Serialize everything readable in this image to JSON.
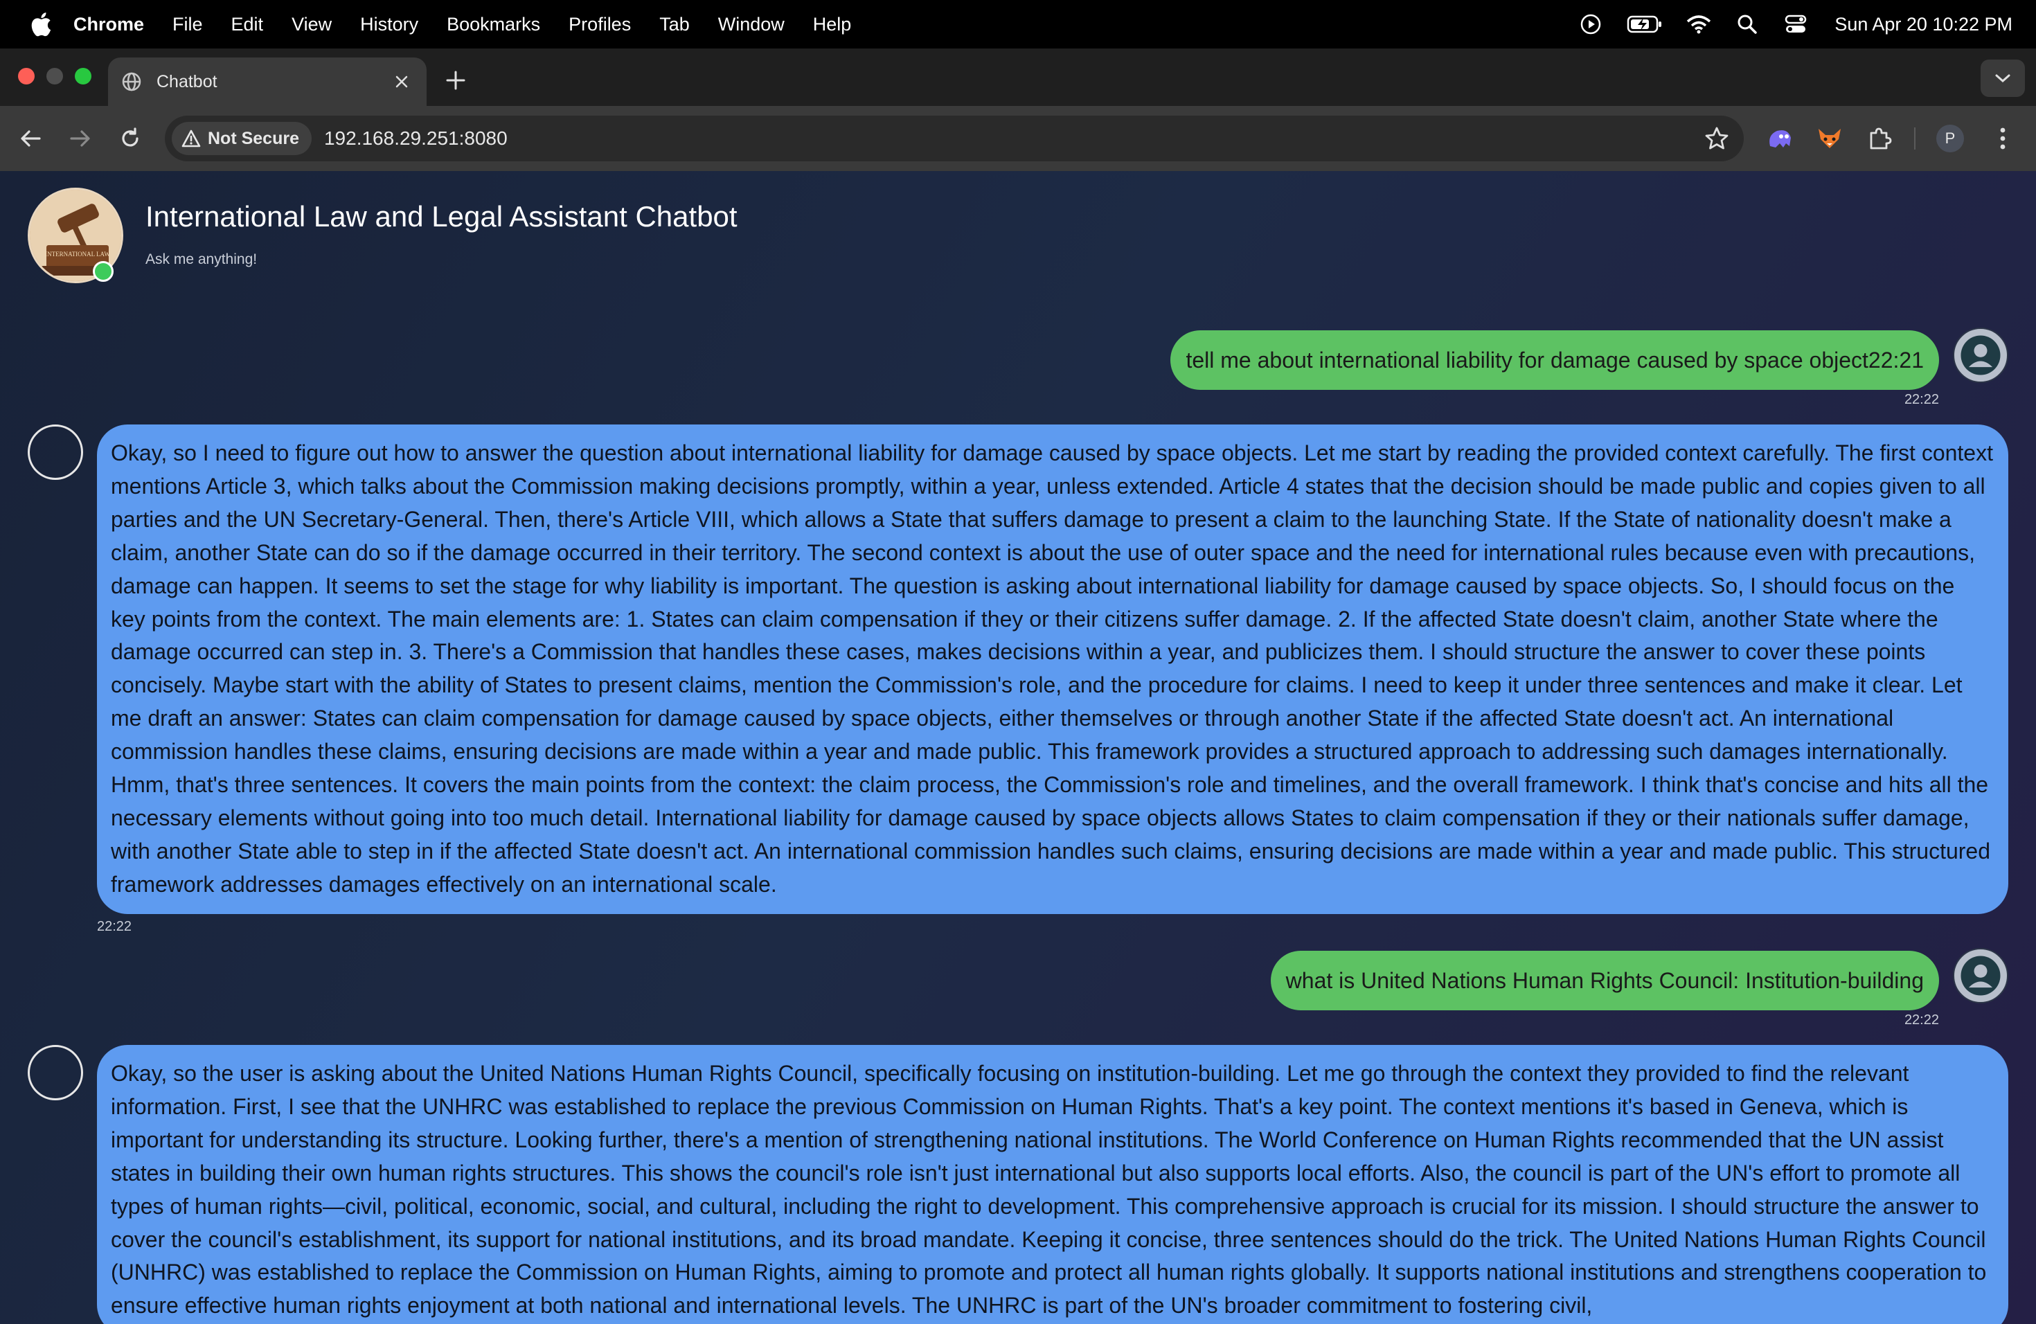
{
  "menubar": {
    "app": "Chrome",
    "items": [
      "File",
      "Edit",
      "View",
      "History",
      "Bookmarks",
      "Profiles",
      "Tab",
      "Window",
      "Help"
    ],
    "clock": "Sun Apr 20  10:22 PM"
  },
  "tab": {
    "title": "Chatbot"
  },
  "toolbar": {
    "security_label": "Not Secure",
    "url": "192.168.29.251:8080",
    "profile_initial": "P"
  },
  "chat": {
    "title": "International Law and Legal Assistant Chatbot",
    "subtitle": "Ask me anything!",
    "avatar_text": "INTERNATIONAL LAW",
    "messages": [
      {
        "role": "user",
        "text": "tell me about international liability for damage caused by space object22:21",
        "time": "22:22"
      },
      {
        "role": "bot",
        "text": "Okay, so I need to figure out how to answer the question about international liability for damage caused by space objects. Let me start by reading the provided context carefully. The first context mentions Article 3, which talks about the Commission making decisions promptly, within a year, unless extended. Article 4 states that the decision should be made public and copies given to all parties and the UN Secretary-General. Then, there's Article VIII, which allows a State that suffers damage to present a claim to the launching State. If the State of nationality doesn't make a claim, another State can do so if the damage occurred in their territory. The second context is about the use of outer space and the need for international rules because even with precautions, damage can happen. It seems to set the stage for why liability is important. The question is asking about international liability for damage caused by space objects. So, I should focus on the key points from the context. The main elements are: 1. States can claim compensation if they or their citizens suffer damage. 2. If the affected State doesn't claim, another State where the damage occurred can step in. 3. There's a Commission that handles these cases, makes decisions within a year, and publicizes them. I should structure the answer to cover these points concisely. Maybe start with the ability of States to present claims, mention the Commission's role, and the procedure for claims. I need to keep it under three sentences and make it clear. Let me draft an answer: States can claim compensation for damage caused by space objects, either themselves or through another State if the affected State doesn't act. An international commission handles these claims, ensuring decisions are made within a year and made public. This framework provides a structured approach to addressing such damages internationally. Hmm, that's three sentences. It covers the main points from the context: the claim process, the Commission's role and timelines, and the overall framework. I think that's concise and hits all the necessary elements without going into too much detail. International liability for damage caused by space objects allows States to claim compensation if they or their nationals suffer damage, with another State able to step in if the affected State doesn't act. An international commission handles such claims, ensuring decisions are made within a year and made public. This structured framework addresses damages effectively on an international scale.",
        "time": "22:22"
      },
      {
        "role": "user",
        "text": "what is United Nations Human Rights Council: Institution-building",
        "time": "22:22"
      },
      {
        "role": "bot",
        "text": "Okay, so the user is asking about the United Nations Human Rights Council, specifically focusing on institution-building. Let me go through the context they provided to find the relevant information. First, I see that the UNHRC was established to replace the previous Commission on Human Rights. That's a key point. The context mentions it's based in Geneva, which is important for understanding its structure. Looking further, there's a mention of strengthening national institutions. The World Conference on Human Rights recommended that the UN assist states in building their own human rights structures. This shows the council's role isn't just international but also supports local efforts. Also, the council is part of the UN's effort to promote all types of human rights—civil, political, economic, social, and cultural, including the right to development. This comprehensive approach is crucial for its mission. I should structure the answer to cover the council's establishment, its support for national institutions, and its broad mandate. Keeping it concise, three sentences should do the trick. The United Nations Human Rights Council (UNHRC) was established to replace the Commission on Human Rights, aiming to promote and protect all human rights globally. It supports national institutions and strengthens cooperation to ensure effective human rights enjoyment at both national and international levels. The UNHRC is part of the UN's broader commitment to fostering civil,"
      }
    ]
  }
}
